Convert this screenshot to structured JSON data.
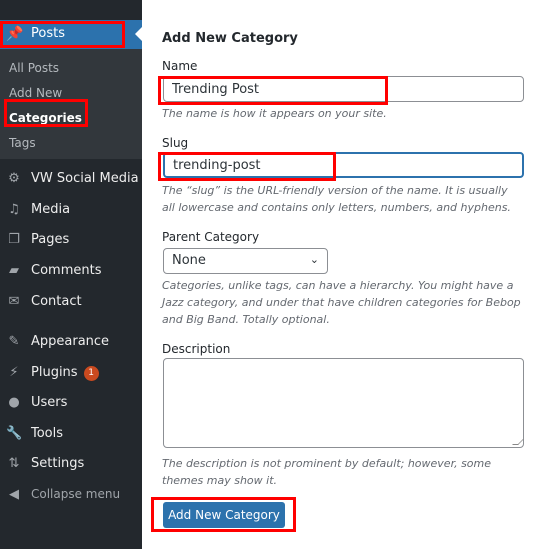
{
  "sidebar": {
    "posts": {
      "label": "Posts",
      "icon": "pushpin-icon"
    },
    "submenu": [
      {
        "label": "All Posts",
        "current": false
      },
      {
        "label": "Add New",
        "current": false
      },
      {
        "label": "Categories",
        "current": true
      },
      {
        "label": "Tags",
        "current": false
      }
    ],
    "items": [
      {
        "label": "VW Social Media",
        "icon": "gear-icon",
        "glyph": "⚙"
      },
      {
        "label": "Media",
        "icon": "media-icon",
        "glyph": "♫"
      },
      {
        "label": "Pages",
        "icon": "pages-icon",
        "glyph": "❐"
      },
      {
        "label": "Comments",
        "icon": "comment-icon",
        "glyph": "▰"
      },
      {
        "label": "Contact",
        "icon": "mail-icon",
        "glyph": "✉"
      },
      {
        "label": "Appearance",
        "icon": "paintbrush-icon",
        "glyph": "✎"
      },
      {
        "label": "Plugins",
        "icon": "plugin-icon",
        "glyph": "⚡",
        "badge": "1"
      },
      {
        "label": "Users",
        "icon": "user-icon",
        "glyph": "●"
      },
      {
        "label": "Tools",
        "icon": "wrench-icon",
        "glyph": "🔧"
      },
      {
        "label": "Settings",
        "icon": "settings-icon",
        "glyph": "⇅"
      },
      {
        "label": "Collapse menu",
        "icon": "collapse-icon",
        "glyph": "◀"
      }
    ]
  },
  "form": {
    "title": "Add New Category",
    "name_label": "Name",
    "name_value": "Trending Post",
    "name_help": "The name is how it appears on your site.",
    "slug_label": "Slug",
    "slug_value": "trending-post",
    "slug_help": "The “slug” is the URL-friendly version of the name. It is usually all lowercase and contains only letters, numbers, and hyphens.",
    "parent_label": "Parent Category",
    "parent_value": "None",
    "parent_help": "Categories, unlike tags, can have a hierarchy. You might have a Jazz category, and under that have children categories for Bebop and Big Band. Totally optional.",
    "description_label": "Description",
    "description_value": "",
    "description_help": "The description is not prominent by default; however, some themes may show it.",
    "submit_label": "Add New Category"
  },
  "colors": {
    "sidebar_bg": "#23282d",
    "submenu_bg": "#32373c",
    "accent": "#2c72ad",
    "badge": "#ca4a1f",
    "annotation": "#ff0000"
  }
}
